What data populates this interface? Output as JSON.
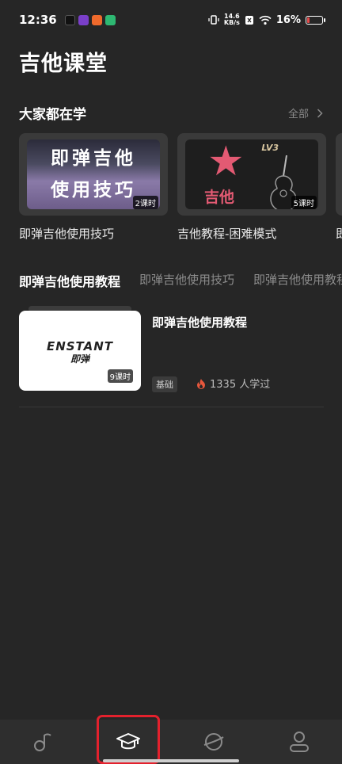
{
  "status_bar": {
    "time": "12:36",
    "net_speed_value": "14.6",
    "net_speed_unit": "KB/s",
    "battery": "16%"
  },
  "page": {
    "title": "吉他课堂"
  },
  "popular": {
    "title": "大家都在学",
    "see_all": "全部",
    "cards": [
      {
        "thumb_line1": "即弹吉他",
        "thumb_line2": "使用技巧",
        "lessons": "2课时",
        "title": "即弹吉他使用技巧"
      },
      {
        "thumb_badge": "LV3",
        "thumb_text": "吉他",
        "lessons": "5课时",
        "title": "吉他教程-困难模式"
      },
      {
        "title": "即"
      }
    ]
  },
  "tabs": [
    {
      "label": "即弹吉他使用教程",
      "active": true
    },
    {
      "label": "即弹吉他使用技巧",
      "active": false
    },
    {
      "label": "即弹吉他使用教程",
      "active": false
    }
  ],
  "course_list": [
    {
      "brand": "ENSTANT",
      "brand_sub": "即弹",
      "lessons": "9课时",
      "title": "即弹吉他使用教程",
      "level": "基础",
      "learners": "1335 人学过"
    }
  ],
  "bottom_nav": [
    {
      "icon": "music-note-icon",
      "active": false
    },
    {
      "icon": "graduation-cap-icon",
      "active": true
    },
    {
      "icon": "planet-icon",
      "active": false
    },
    {
      "icon": "profile-icon",
      "active": false
    }
  ],
  "colors": {
    "background": "#262626",
    "accent_star": "#e35a73",
    "highlight_box": "#e3212d",
    "fire": "#e8573c"
  }
}
